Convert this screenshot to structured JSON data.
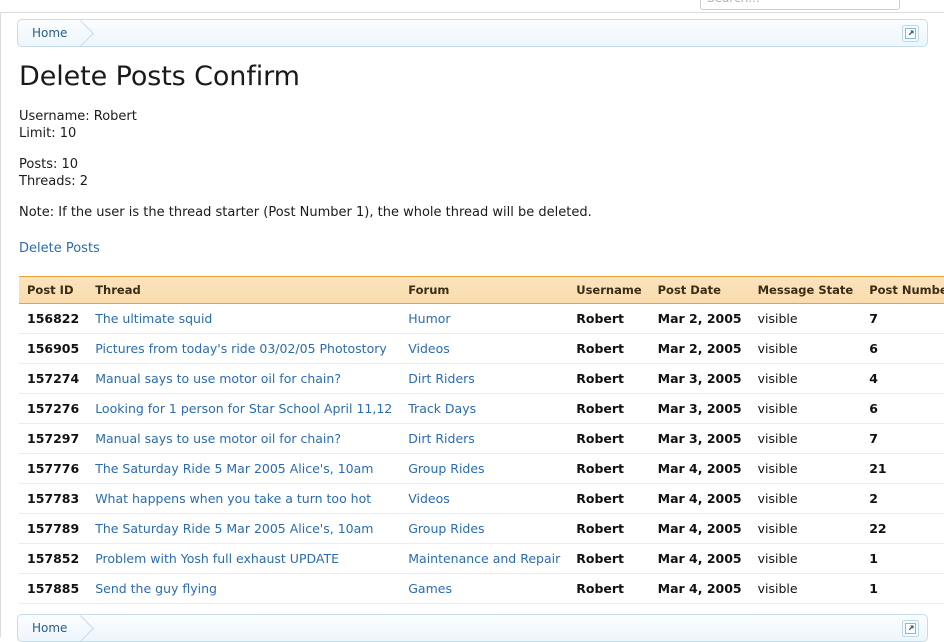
{
  "search": {
    "placeholder": "Search...",
    "value": ""
  },
  "navbar": {
    "home_label": "Home",
    "popup_icon": "open-in-new-window-icon"
  },
  "page": {
    "title": "Delete Posts Confirm",
    "username_line": "Username: Robert",
    "limit_line": "Limit: 10",
    "posts_line": "Posts: 10",
    "threads_line": "Threads: 2",
    "note": "Note: If the user is the thread starter (Post Number 1), the whole thread will be deleted.",
    "delete_link": "Delete Posts"
  },
  "table": {
    "headers": [
      "Post ID",
      "Thread",
      "Forum",
      "Username",
      "Post Date",
      "Message State",
      "Post Number"
    ],
    "rows": [
      {
        "post_id": "156822",
        "thread": "The ultimate squid",
        "forum": "Humor",
        "username": "Robert",
        "post_date": "Mar 2, 2005",
        "message_state": "visible",
        "post_number": "7"
      },
      {
        "post_id": "156905",
        "thread": "Pictures from today's ride 03/02/05 Photostory",
        "forum": "Videos",
        "username": "Robert",
        "post_date": "Mar 2, 2005",
        "message_state": "visible",
        "post_number": "6"
      },
      {
        "post_id": "157274",
        "thread": "Manual says to use motor oil for chain?",
        "forum": "Dirt Riders",
        "username": "Robert",
        "post_date": "Mar 3, 2005",
        "message_state": "visible",
        "post_number": "4"
      },
      {
        "post_id": "157276",
        "thread": "Looking for 1 person for Star School April 11,12",
        "forum": "Track Days",
        "username": "Robert",
        "post_date": "Mar 3, 2005",
        "message_state": "visible",
        "post_number": "6"
      },
      {
        "post_id": "157297",
        "thread": "Manual says to use motor oil for chain?",
        "forum": "Dirt Riders",
        "username": "Robert",
        "post_date": "Mar 3, 2005",
        "message_state": "visible",
        "post_number": "7"
      },
      {
        "post_id": "157776",
        "thread": "The Saturday Ride 5 Mar 2005 Alice's, 10am",
        "forum": "Group Rides",
        "username": "Robert",
        "post_date": "Mar 4, 2005",
        "message_state": "visible",
        "post_number": "21"
      },
      {
        "post_id": "157783",
        "thread": "What happens when you take a turn too hot",
        "forum": "Videos",
        "username": "Robert",
        "post_date": "Mar 4, 2005",
        "message_state": "visible",
        "post_number": "2"
      },
      {
        "post_id": "157789",
        "thread": "The Saturday Ride 5 Mar 2005 Alice's, 10am",
        "forum": "Group Rides",
        "username": "Robert",
        "post_date": "Mar 4, 2005",
        "message_state": "visible",
        "post_number": "22"
      },
      {
        "post_id": "157852",
        "thread": "Problem with Yosh full exhaust UPDATE",
        "forum": "Maintenance and Repair",
        "username": "Robert",
        "post_date": "Mar 4, 2005",
        "message_state": "visible",
        "post_number": "1"
      },
      {
        "post_id": "157885",
        "thread": "Send the guy flying",
        "forum": "Games",
        "username": "Robert",
        "post_date": "Mar 4, 2005",
        "message_state": "visible",
        "post_number": "1"
      }
    ]
  },
  "colors": {
    "link": "#2b6cb0",
    "header_bg": "#f9dcac",
    "header_border": "#e8a33d",
    "navbar_border": "#c5dcea",
    "row_border": "#e3eef5"
  }
}
